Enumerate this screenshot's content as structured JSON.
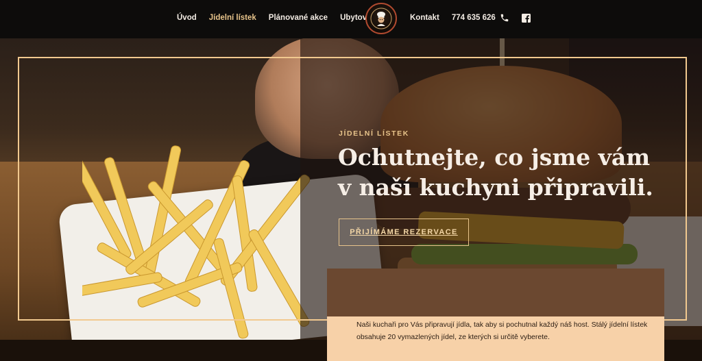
{
  "nav": {
    "left": [
      "Úvod",
      "Jídelní lístek",
      "Plánované akce",
      "Ubytování"
    ],
    "active_index": 1,
    "contact_label": "Kontakt",
    "phone": "774 635 626"
  },
  "icons": {
    "phone": "phone-icon",
    "facebook": "facebook-icon",
    "logo": "chef-logo"
  },
  "hero": {
    "kicker": "JÍDELNÍ LÍSTEK",
    "headline": "Ochutnejte, co jsme vám v naší kuchyni připravili.",
    "cta": "PŘIJÍMÁME REZERVACE"
  },
  "intro": {
    "text": "Naši kuchaři pro Vás připravují jídla, tak aby si pochutnal každý náš host. Stálý jídelní lístek obsahuje 20 vymazlených jídel, ze kterých si určitě vyberete."
  },
  "colors": {
    "accent": "#e8c48b",
    "frame": "#f2c98f",
    "panel": "#f7d1a8",
    "header_bg": "#0d0c0b"
  }
}
